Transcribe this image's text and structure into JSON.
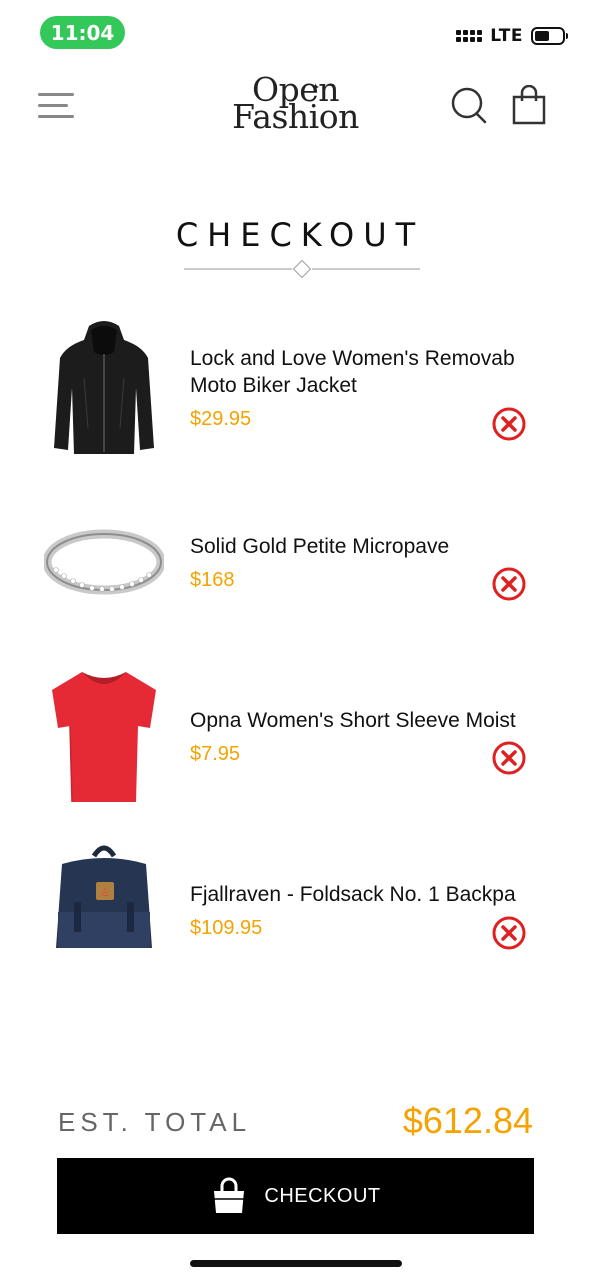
{
  "status_bar": {
    "time": "11:04",
    "network": "LTE"
  },
  "header": {
    "logo_line1": "Open",
    "logo_line2": "Fashion",
    "icons": [
      "menu-icon",
      "search-icon",
      "shopping-bag-icon"
    ]
  },
  "page": {
    "title": "CHECKOUT"
  },
  "items": [
    {
      "name_line1": "Lock and Love Women's Removab",
      "name_line2": "Moto Biker Jacket",
      "price": "$29.95",
      "thumb": "black-jacket"
    },
    {
      "name_line1": "Solid Gold Petite Micropave",
      "name_line2": "",
      "price": "$168",
      "thumb": "silver-ring"
    },
    {
      "name_line1": "Opna Women's Short Sleeve Moist",
      "name_line2": "",
      "price": "$7.95",
      "thumb": "red-tshirt"
    },
    {
      "name_line1": "Fjallraven - Foldsack No. 1 Backpa",
      "name_line2": "",
      "price": "$109.95",
      "thumb": "navy-backpack"
    }
  ],
  "summary": {
    "total_label": "EST. TOTAL",
    "total_value": "$612.84"
  },
  "checkout_button": {
    "label": "CHECKOUT"
  },
  "colors": {
    "price": "#f4a300",
    "remove": "#e02020",
    "button_bg": "#000000",
    "status_pill": "#34c759"
  }
}
